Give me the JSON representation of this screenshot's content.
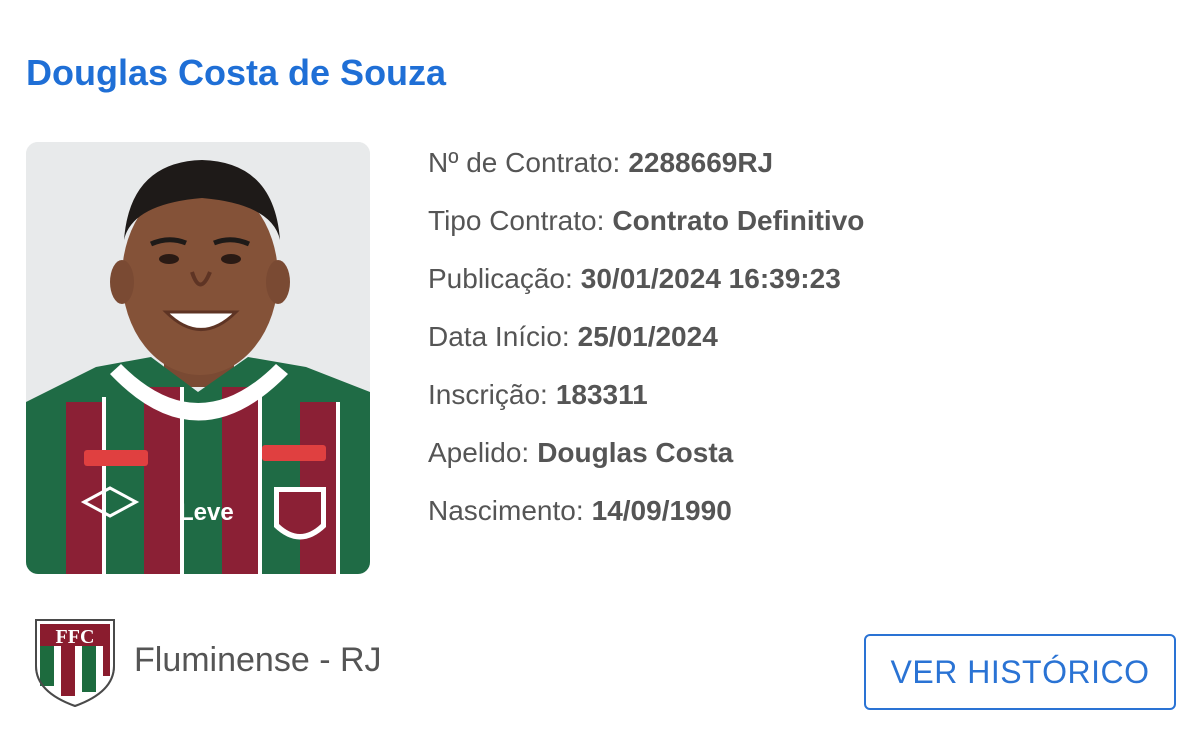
{
  "player": {
    "full_name": "Douglas Costa de Souza",
    "photo_alt": "Douglas Costa de Souza"
  },
  "contract": {
    "rows": [
      {
        "label": "Nº de Contrato:",
        "value": "2288669RJ"
      },
      {
        "label": "Tipo Contrato:",
        "value": "Contrato Definitivo"
      },
      {
        "label": "Publicação:",
        "value": "30/01/2024 16:39:23"
      },
      {
        "label": "Data Início:",
        "value": "25/01/2024"
      },
      {
        "label": "Inscrição:",
        "value": "183311"
      },
      {
        "label": "Apelido:",
        "value": "Douglas Costa"
      },
      {
        "label": "Nascimento:",
        "value": "14/09/1990"
      }
    ]
  },
  "club": {
    "name": "Fluminense - RJ",
    "crest_icon": "fluminense-crest-icon"
  },
  "actions": {
    "history_label": "VER HISTÓRICO"
  },
  "colors": {
    "title": "#1f6fd6",
    "button": "#2a73d4",
    "text": "#555555",
    "club_green": "#1d6b3e",
    "club_maroon": "#8a1c2e"
  }
}
